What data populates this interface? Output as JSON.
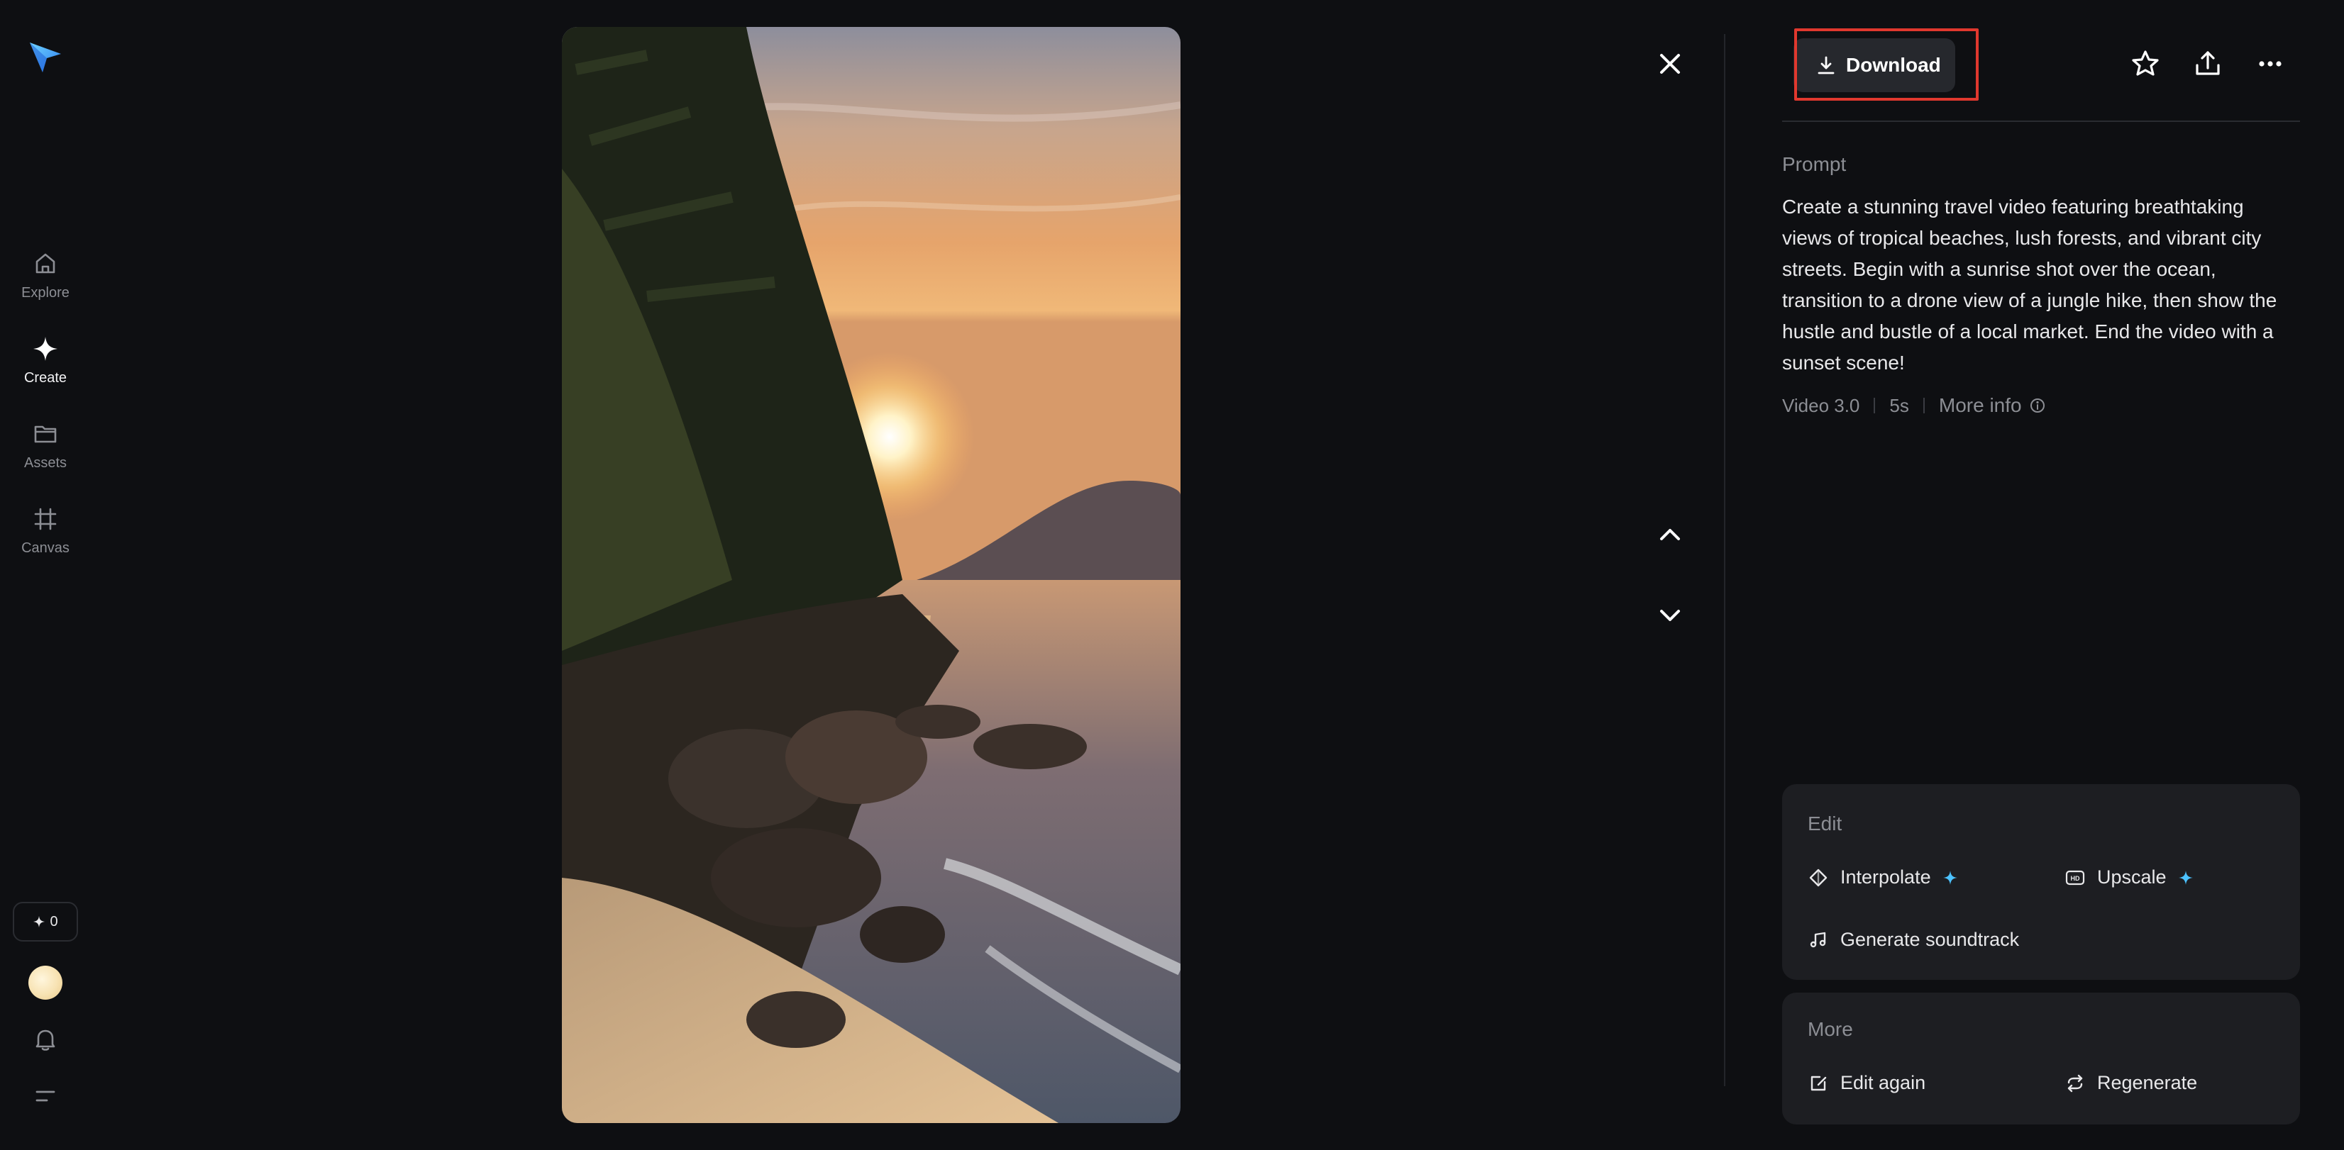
{
  "sidebar": {
    "items": [
      {
        "label": "Explore",
        "icon": "home-icon"
      },
      {
        "label": "Create",
        "icon": "sparkle-icon"
      },
      {
        "label": "Assets",
        "icon": "folder-icon"
      },
      {
        "label": "Canvas",
        "icon": "frame-icon"
      }
    ],
    "credits": "0"
  },
  "header": {
    "download_label": "Download"
  },
  "prompt": {
    "label": "Prompt",
    "text": "Create a stunning travel video featuring breathtaking views of tropical beaches, lush forests, and vibrant city streets. Begin with a sunrise shot over the ocean, transition to a drone view of a jungle hike, then show the hustle and bustle of a local market. End the video with a sunset scene!"
  },
  "meta": {
    "model": "Video 3.0",
    "duration": "5s",
    "more_info": "More info"
  },
  "edit_card": {
    "title": "Edit",
    "actions": [
      {
        "label": "Interpolate",
        "icon": "interpolate-icon"
      },
      {
        "label": "Upscale",
        "icon": "hd-icon"
      },
      {
        "label": "Generate soundtrack",
        "icon": "music-note-icon"
      }
    ]
  },
  "more_card": {
    "title": "More",
    "actions": [
      {
        "label": "Edit again",
        "icon": "edit-icon"
      },
      {
        "label": "Regenerate",
        "icon": "regenerate-icon"
      }
    ]
  },
  "colors": {
    "background": "#0e0f12",
    "card": "#1d1e22",
    "accent": "#4cc2ff",
    "highlight": "#e0382e"
  }
}
